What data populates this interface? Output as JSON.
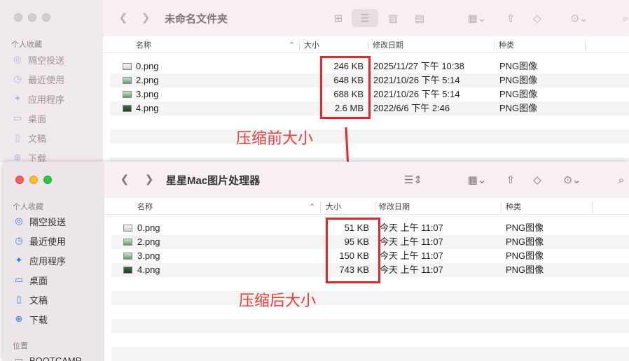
{
  "win1": {
    "title": "未命名文件夹",
    "sidebar": {
      "section": "个人收藏",
      "items": [
        {
          "label": "隔空投送",
          "icon": "airdrop-icon"
        },
        {
          "label": "最近使用",
          "icon": "clock-icon"
        },
        {
          "label": "应用程序",
          "icon": "apps-icon"
        },
        {
          "label": "桌面",
          "icon": "desktop-icon"
        },
        {
          "label": "文稿",
          "icon": "document-icon"
        },
        {
          "label": "下载",
          "icon": "download-icon"
        }
      ]
    },
    "columns": {
      "name": "名称",
      "size": "大小",
      "date": "修改日期",
      "kind": "种类"
    },
    "files": [
      {
        "name": "0.png",
        "size": "246 KB",
        "date": "2025/11/27 下午 10:38",
        "kind": "PNG图像"
      },
      {
        "name": "2.png",
        "size": "648 KB",
        "date": "2021/10/26 下午 5:14",
        "kind": "PNG图像"
      },
      {
        "name": "3.png",
        "size": "688 KB",
        "date": "2021/10/26 下午 5:14",
        "kind": "PNG图像"
      },
      {
        "name": "4.png",
        "size": "2.6 MB",
        "date": "2022/6/6 下午 2:46",
        "kind": "PNG图像"
      }
    ],
    "annotation": "压缩前大小"
  },
  "win2": {
    "title": "星星Mac图片处理器",
    "sidebar": {
      "section": "个人收藏",
      "items": [
        {
          "label": "隔空投送",
          "icon": "airdrop-icon"
        },
        {
          "label": "最近使用",
          "icon": "clock-icon"
        },
        {
          "label": "应用程序",
          "icon": "apps-icon"
        },
        {
          "label": "桌面",
          "icon": "desktop-icon"
        },
        {
          "label": "文稿",
          "icon": "document-icon"
        },
        {
          "label": "下载",
          "icon": "download-icon"
        }
      ],
      "section2": "位置",
      "location": "BOOTCAMP"
    },
    "columns": {
      "name": "名称",
      "size": "大小",
      "date": "修改日期",
      "kind": "种类"
    },
    "files": [
      {
        "name": "0.png",
        "size": "51 KB",
        "date": "今天 上午 11:07",
        "kind": "PNG图像"
      },
      {
        "name": "2.png",
        "size": "95 KB",
        "date": "今天 上午 11:07",
        "kind": "PNG图像"
      },
      {
        "name": "3.png",
        "size": "150 KB",
        "date": "今天 上午 11:07",
        "kind": "PNG图像"
      },
      {
        "name": "4.png",
        "size": "743 KB",
        "date": "今天 上午 11:07",
        "kind": "PNG图像"
      }
    ],
    "annotation": "压缩后大小"
  },
  "colors": {
    "annotation_red": "#e6262c",
    "accent": "#3478f6"
  }
}
